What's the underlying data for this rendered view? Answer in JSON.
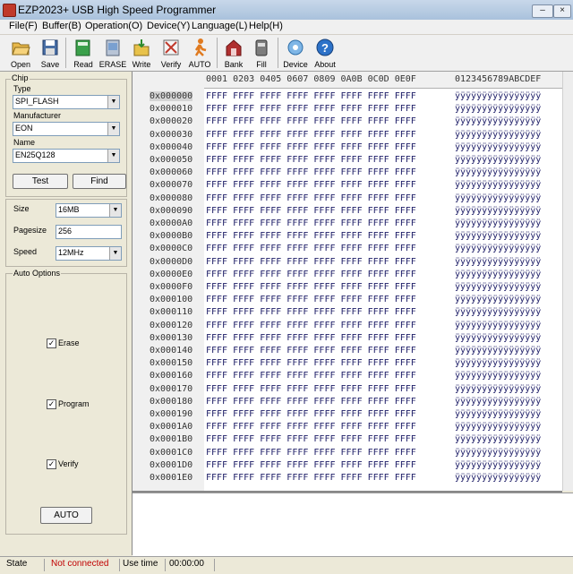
{
  "window": {
    "title": "EZP2023+ USB High Speed Programmer"
  },
  "menu": [
    "File(F)",
    "Buffer(B)",
    "Operation(O)",
    "Device(Y)",
    "Language(L)",
    "Help(H)"
  ],
  "toolbar": {
    "open": "Open",
    "save": "Save",
    "read": "Read",
    "erase": "ERASE",
    "write": "Write",
    "verify": "Verify",
    "auto": "AUTO",
    "bank": "Bank",
    "fill": "Fill",
    "device": "Device",
    "about": "About"
  },
  "chip": {
    "group_label": "Chip",
    "type_label": "Type",
    "type_value": "SPI_FLASH",
    "manufacturer_label": "Manufacturer",
    "manufacturer_value": "EON",
    "name_label": "Name",
    "name_value": "EN25Q128",
    "test_button": "Test",
    "find_button": "Find"
  },
  "settings": {
    "size_label": "Size",
    "size_value": "16MB",
    "pagesize_label": "Pagesize",
    "pagesize_value": "256",
    "speed_label": "Speed",
    "speed_value": "12MHz"
  },
  "auto_options": {
    "group_label": "Auto Options",
    "erase_label": "Erase",
    "erase_checked": true,
    "program_label": "Program",
    "program_checked": true,
    "verify_label": "Verify",
    "verify_checked": true,
    "auto_button": "AUTO"
  },
  "hex": {
    "header_cols": "0001 0203 0405 0607 0809 0A0B 0C0D 0E0F",
    "header_ascii": "0123456789ABCDEF",
    "rows": [
      {
        "addr": "0x000000",
        "hex": "FFFF FFFF FFFF FFFF FFFF FFFF FFFF FFFF",
        "ascii": "ÿÿÿÿÿÿÿÿÿÿÿÿÿÿÿÿ"
      },
      {
        "addr": "0x000010",
        "hex": "FFFF FFFF FFFF FFFF FFFF FFFF FFFF FFFF",
        "ascii": "ÿÿÿÿÿÿÿÿÿÿÿÿÿÿÿÿ"
      },
      {
        "addr": "0x000020",
        "hex": "FFFF FFFF FFFF FFFF FFFF FFFF FFFF FFFF",
        "ascii": "ÿÿÿÿÿÿÿÿÿÿÿÿÿÿÿÿ"
      },
      {
        "addr": "0x000030",
        "hex": "FFFF FFFF FFFF FFFF FFFF FFFF FFFF FFFF",
        "ascii": "ÿÿÿÿÿÿÿÿÿÿÿÿÿÿÿÿ"
      },
      {
        "addr": "0x000040",
        "hex": "FFFF FFFF FFFF FFFF FFFF FFFF FFFF FFFF",
        "ascii": "ÿÿÿÿÿÿÿÿÿÿÿÿÿÿÿÿ"
      },
      {
        "addr": "0x000050",
        "hex": "FFFF FFFF FFFF FFFF FFFF FFFF FFFF FFFF",
        "ascii": "ÿÿÿÿÿÿÿÿÿÿÿÿÿÿÿÿ"
      },
      {
        "addr": "0x000060",
        "hex": "FFFF FFFF FFFF FFFF FFFF FFFF FFFF FFFF",
        "ascii": "ÿÿÿÿÿÿÿÿÿÿÿÿÿÿÿÿ"
      },
      {
        "addr": "0x000070",
        "hex": "FFFF FFFF FFFF FFFF FFFF FFFF FFFF FFFF",
        "ascii": "ÿÿÿÿÿÿÿÿÿÿÿÿÿÿÿÿ"
      },
      {
        "addr": "0x000080",
        "hex": "FFFF FFFF FFFF FFFF FFFF FFFF FFFF FFFF",
        "ascii": "ÿÿÿÿÿÿÿÿÿÿÿÿÿÿÿÿ"
      },
      {
        "addr": "0x000090",
        "hex": "FFFF FFFF FFFF FFFF FFFF FFFF FFFF FFFF",
        "ascii": "ÿÿÿÿÿÿÿÿÿÿÿÿÿÿÿÿ"
      },
      {
        "addr": "0x0000A0",
        "hex": "FFFF FFFF FFFF FFFF FFFF FFFF FFFF FFFF",
        "ascii": "ÿÿÿÿÿÿÿÿÿÿÿÿÿÿÿÿ"
      },
      {
        "addr": "0x0000B0",
        "hex": "FFFF FFFF FFFF FFFF FFFF FFFF FFFF FFFF",
        "ascii": "ÿÿÿÿÿÿÿÿÿÿÿÿÿÿÿÿ"
      },
      {
        "addr": "0x0000C0",
        "hex": "FFFF FFFF FFFF FFFF FFFF FFFF FFFF FFFF",
        "ascii": "ÿÿÿÿÿÿÿÿÿÿÿÿÿÿÿÿ"
      },
      {
        "addr": "0x0000D0",
        "hex": "FFFF FFFF FFFF FFFF FFFF FFFF FFFF FFFF",
        "ascii": "ÿÿÿÿÿÿÿÿÿÿÿÿÿÿÿÿ"
      },
      {
        "addr": "0x0000E0",
        "hex": "FFFF FFFF FFFF FFFF FFFF FFFF FFFF FFFF",
        "ascii": "ÿÿÿÿÿÿÿÿÿÿÿÿÿÿÿÿ"
      },
      {
        "addr": "0x0000F0",
        "hex": "FFFF FFFF FFFF FFFF FFFF FFFF FFFF FFFF",
        "ascii": "ÿÿÿÿÿÿÿÿÿÿÿÿÿÿÿÿ"
      },
      {
        "addr": "0x000100",
        "hex": "FFFF FFFF FFFF FFFF FFFF FFFF FFFF FFFF",
        "ascii": "ÿÿÿÿÿÿÿÿÿÿÿÿÿÿÿÿ"
      },
      {
        "addr": "0x000110",
        "hex": "FFFF FFFF FFFF FFFF FFFF FFFF FFFF FFFF",
        "ascii": "ÿÿÿÿÿÿÿÿÿÿÿÿÿÿÿÿ"
      },
      {
        "addr": "0x000120",
        "hex": "FFFF FFFF FFFF FFFF FFFF FFFF FFFF FFFF",
        "ascii": "ÿÿÿÿÿÿÿÿÿÿÿÿÿÿÿÿ"
      },
      {
        "addr": "0x000130",
        "hex": "FFFF FFFF FFFF FFFF FFFF FFFF FFFF FFFF",
        "ascii": "ÿÿÿÿÿÿÿÿÿÿÿÿÿÿÿÿ"
      },
      {
        "addr": "0x000140",
        "hex": "FFFF FFFF FFFF FFFF FFFF FFFF FFFF FFFF",
        "ascii": "ÿÿÿÿÿÿÿÿÿÿÿÿÿÿÿÿ"
      },
      {
        "addr": "0x000150",
        "hex": "FFFF FFFF FFFF FFFF FFFF FFFF FFFF FFFF",
        "ascii": "ÿÿÿÿÿÿÿÿÿÿÿÿÿÿÿÿ"
      },
      {
        "addr": "0x000160",
        "hex": "FFFF FFFF FFFF FFFF FFFF FFFF FFFF FFFF",
        "ascii": "ÿÿÿÿÿÿÿÿÿÿÿÿÿÿÿÿ"
      },
      {
        "addr": "0x000170",
        "hex": "FFFF FFFF FFFF FFFF FFFF FFFF FFFF FFFF",
        "ascii": "ÿÿÿÿÿÿÿÿÿÿÿÿÿÿÿÿ"
      },
      {
        "addr": "0x000180",
        "hex": "FFFF FFFF FFFF FFFF FFFF FFFF FFFF FFFF",
        "ascii": "ÿÿÿÿÿÿÿÿÿÿÿÿÿÿÿÿ"
      },
      {
        "addr": "0x000190",
        "hex": "FFFF FFFF FFFF FFFF FFFF FFFF FFFF FFFF",
        "ascii": "ÿÿÿÿÿÿÿÿÿÿÿÿÿÿÿÿ"
      },
      {
        "addr": "0x0001A0",
        "hex": "FFFF FFFF FFFF FFFF FFFF FFFF FFFF FFFF",
        "ascii": "ÿÿÿÿÿÿÿÿÿÿÿÿÿÿÿÿ"
      },
      {
        "addr": "0x0001B0",
        "hex": "FFFF FFFF FFFF FFFF FFFF FFFF FFFF FFFF",
        "ascii": "ÿÿÿÿÿÿÿÿÿÿÿÿÿÿÿÿ"
      },
      {
        "addr": "0x0001C0",
        "hex": "FFFF FFFF FFFF FFFF FFFF FFFF FFFF FFFF",
        "ascii": "ÿÿÿÿÿÿÿÿÿÿÿÿÿÿÿÿ"
      },
      {
        "addr": "0x0001D0",
        "hex": "FFFF FFFF FFFF FFFF FFFF FFFF FFFF FFFF",
        "ascii": "ÿÿÿÿÿÿÿÿÿÿÿÿÿÿÿÿ"
      },
      {
        "addr": "0x0001E0",
        "hex": "FFFF FFFF FFFF FFFF FFFF FFFF FFFF FFFF",
        "ascii": "ÿÿÿÿÿÿÿÿÿÿÿÿÿÿÿÿ"
      }
    ]
  },
  "status": {
    "state_label": "State",
    "state_value": "Not connected",
    "state_color": "#c00000",
    "usetime_label": "Use time",
    "usetime_value": "00:00:00"
  }
}
